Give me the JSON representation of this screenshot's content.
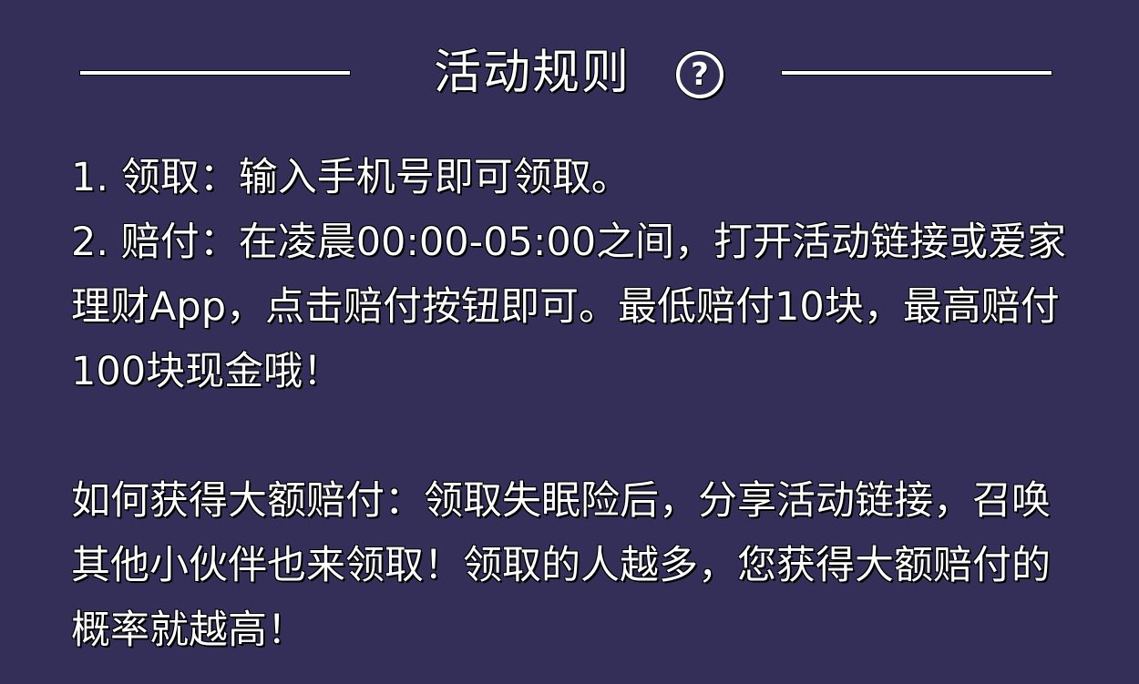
{
  "header": {
    "title": "活动规则",
    "help_icon_glyph": "?",
    "icon": "question-circle-icon"
  },
  "rules": [
    "1. 领取：输入手机号即可领取。",
    "2. 赔付：在凌晨00:00-05:00之间，打开活动链接或爱家理财App，点击赔付按钮即可。最低赔付10块，最高赔付100块现金哦！"
  ],
  "tip": "如何获得大额赔付：领取失眠险后，分享活动链接，召唤其他小伙伴也来领取！领取的人越多，您获得大额赔付的概率就越高！",
  "colors": {
    "background": "#332f58",
    "text": "#ffffff"
  }
}
